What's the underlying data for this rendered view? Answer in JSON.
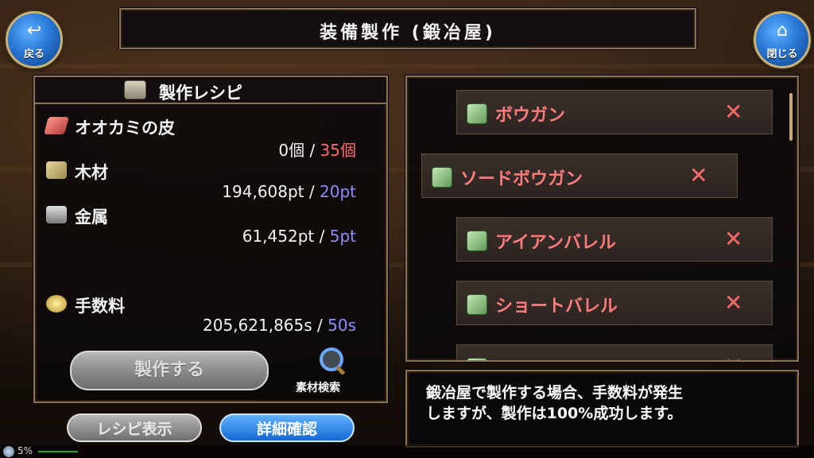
{
  "header": {
    "title": "装備製作 (鍛冶屋)"
  },
  "nav": {
    "back_label": "戻る",
    "back_icon": "back-arrow-icon",
    "close_label": "閉じる",
    "close_icon": "home-icon"
  },
  "recipe": {
    "title": "製作レシピ",
    "materials": [
      {
        "name": "オオカミの皮",
        "owned": "0個",
        "separator": "/",
        "required": "35個",
        "required_color": "#ff6b6b",
        "icon": "wolf-pelt-icon"
      },
      {
        "name": "木材",
        "owned": "194,608pt",
        "separator": "/",
        "required": "20pt",
        "required_color": "#8f8cff",
        "icon": "wood-icon"
      },
      {
        "name": "金属",
        "owned": "61,452pt",
        "separator": "/",
        "required": "5pt",
        "required_color": "#8f8cff",
        "icon": "metal-icon"
      }
    ],
    "fee": {
      "name": "手数料",
      "owned": "205,621,865s",
      "separator": "/",
      "required": "50s",
      "icon": "coins-icon"
    },
    "craft_button": "製作する",
    "search_label": "素材検索"
  },
  "buttons": {
    "recipe_view": "レシピ表示",
    "details": "詳細確認"
  },
  "list": {
    "items": [
      {
        "label": "ボウガン",
        "icon": "crossbow-icon",
        "remove": "✕"
      },
      {
        "label": "ソードボウガン",
        "icon": "crossbow-icon",
        "remove": "✕"
      },
      {
        "label": "アイアンバレル",
        "icon": "crossbow-icon",
        "remove": "✕"
      },
      {
        "label": "ショートバレル",
        "icon": "crossbow-icon",
        "remove": "✕"
      },
      {
        "label": "ハンターボウガン",
        "icon": "crossbow-icon",
        "remove": "✕"
      }
    ]
  },
  "message": {
    "line1": "鍛冶屋で製作する場合、手数料が発生",
    "line2": "しますが、製作は100%成功します。"
  },
  "status": {
    "percent": "5%"
  }
}
